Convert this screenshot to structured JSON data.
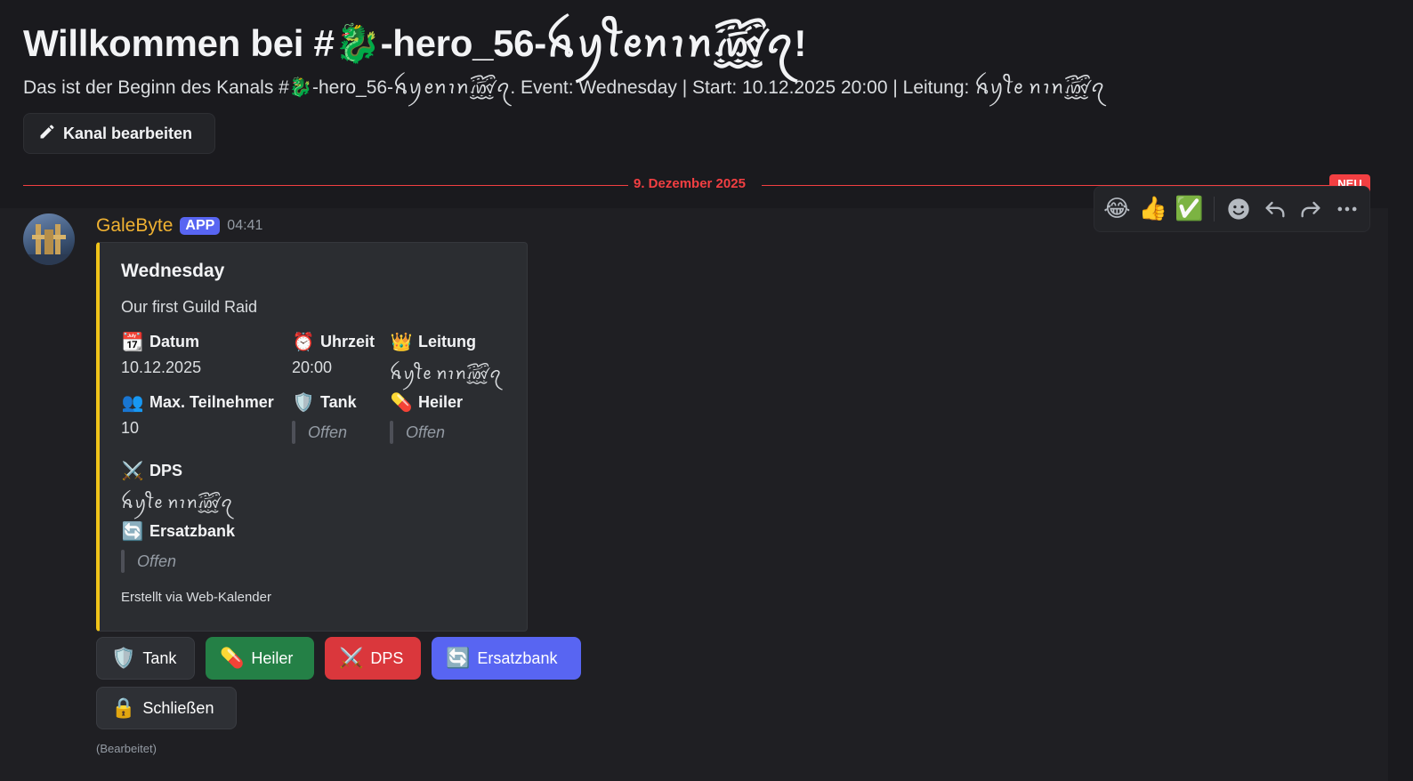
{
  "header": {
    "title": "Willkommen bei #🐉-hero_56-ꫝꪗꪻꫀꪀꪱꪀ꫞ꪖ!",
    "subtitle": "Das ist der Beginn des Kanals #🐉-hero_56-ꫝꪗꫀꪀꪱꪀ꫞ꪖ. Event: Wednesday | Start: 10.12.2025 20:00 | Leitung: ꫝꪗꪻꫀ ꪀꪱꪀ꫞ꪖ",
    "edit_button_label": "Kanal bearbeiten"
  },
  "divider": {
    "date_label": "9. Dezember 2025",
    "new_badge": "NEU"
  },
  "message": {
    "author": "GaleByte",
    "app_tag": "APP",
    "time": "04:41",
    "edited_label": "(Bearbeitet)"
  },
  "toolbar": {
    "reactions": [
      "😂",
      "👍",
      "✅"
    ]
  },
  "embed": {
    "title": "Wednesday",
    "description": "Our first Guild Raid",
    "fields": {
      "datum": {
        "icon": "📆",
        "name": "Datum",
        "value": "10.12.2025"
      },
      "uhrzeit": {
        "icon": "⏰",
        "name": "Uhrzeit",
        "value": "20:00"
      },
      "leitung": {
        "icon": "👑",
        "name": "Leitung",
        "value": "ꫝꪗꪻꫀ ꪀꪱꪀ꫞ꪖ"
      },
      "max": {
        "icon": "👥",
        "name": "Max. Teilnehmer",
        "value": "10"
      },
      "tank": {
        "icon": "🛡️",
        "name": "Tank",
        "value": "Offen"
      },
      "heiler": {
        "icon": "💊",
        "name": "Heiler",
        "value": "Offen"
      },
      "dps": {
        "icon": "⚔️",
        "name": "DPS",
        "value": "ꫝꪗꪻꫀ ꪀꪱꪀ꫞ꪖ"
      },
      "ersatzbank": {
        "icon": "🔄",
        "name": "Ersatzbank",
        "value": "Offen"
      }
    },
    "footer": "Erstellt via Web-Kalender",
    "accent_color": "#f0c419"
  },
  "buttons": {
    "tank": {
      "icon": "🛡️",
      "label": "Tank"
    },
    "heiler": {
      "icon": "💊",
      "label": "Heiler",
      "color": "#248046"
    },
    "dps": {
      "icon": "⚔️",
      "label": "DPS",
      "color": "#da373c"
    },
    "ersatzbank": {
      "icon": "🔄",
      "label": "Ersatzbank",
      "color": "#5865f2"
    },
    "schliessen": {
      "icon": "🔒",
      "label": "Schließen"
    }
  }
}
